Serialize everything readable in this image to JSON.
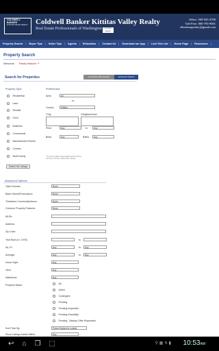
{
  "header": {
    "brand": "Coldwell Banker Kittitas Valley Realty",
    "slogan": "Real Estate Professionals of Washington",
    "office": "Office: 509-925-4700",
    "tollfree": "Toll-Free: 800-795-9001",
    "email": "ellensburgrealty@gmail.com",
    "logo_line1": "COLDWELL",
    "logo_line2": "BANKER",
    "logo_tag": "KITTITAS VALLEY REALTY",
    "emblem": "COLDWELL BANKER"
  },
  "nav": {
    "items": [
      "Property Search",
      "Buyer Tips",
      "Seller Tips",
      "Agents",
      "Relocation",
      "Contact Us",
      "Download our App",
      "Link This List",
      "Home Page",
      "Resources"
    ]
  },
  "page": {
    "title": "Property Search",
    "welcome_label": "Welcome",
    "welcome_user": "Realty Watcher **",
    "search_props_title": "Search for Properties",
    "tab_map": "Interactive Map Search",
    "tab_advanced": "Advanced Search"
  },
  "property_type": {
    "heading": "Property Type",
    "options": [
      "Residential",
      "Land",
      "Rentals",
      "Farm",
      "Business",
      "Commercial",
      "Manufactured Homes",
      "Condos",
      "Multi-Family"
    ]
  },
  "preferences": {
    "heading": "Preferences",
    "area_label": "Area:",
    "area_value": "All",
    "or_label": "- or -",
    "county_label": "County:",
    "county_value": "Kittitas",
    "city_label": "*City:",
    "neighborhood_label": "*Neighborhood:",
    "price_label": "Price:",
    "price_min": "Any",
    "price_to": "to",
    "price_max": "Any",
    "beds_label": "Beds:",
    "beds_value": "Any",
    "baths_label": "Baths:",
    "baths_value": "Any",
    "note": "* To select multiple cities/neighborhoods hold the Ctrl key (or ⌘ key on Mac) while clicking."
  },
  "search_button": "Search the Listings",
  "advanced": {
    "title": "Advanced Options",
    "fields": [
      {
        "label": "Open Houses:",
        "value": "None"
      },
      {
        "label": "Bank Owned/Foreclosure:",
        "value": "None"
      },
      {
        "label": "Timeshare Community/Assoc:",
        "value": "None"
      },
      {
        "label": "Common Property Features:",
        "value": "None"
      },
      {
        "label": "MLS#:",
        "value": ""
      },
      {
        "label": "Address:",
        "value": ""
      },
      {
        "label": "Zip Code:",
        "value": ""
      },
      {
        "label": "Year Built (i.e. 1975):",
        "value": ""
      },
      {
        "label": "Sq. Ft.:",
        "value": "Any"
      },
      {
        "label": "Acreage:",
        "value": "Any"
      },
      {
        "label": "Home Style:",
        "value": "Any"
      },
      {
        "label": "View:",
        "value": "Any"
      },
      {
        "label": "Waterfront:",
        "value": "Any"
      }
    ],
    "to_label": "to",
    "sqft_max": "Any",
    "acreage_max": "Any",
    "status_label": "Property Status:",
    "status_options": [
      "All",
      "Active",
      "Contingent",
      "Pending",
      "Pending Inspection",
      "Pending Feasibility",
      "Pending - Backup Offer Requested"
    ],
    "sort_label": "Sort Price By:",
    "sort_value": "Priced Highest to Lowest",
    "added_label": "Show Listings Added Within:",
    "added_value": "Any"
  },
  "system": {
    "clock": "10:53",
    "ampm": "AM",
    "icons": "⚲ ▦ ↯ ▮"
  }
}
